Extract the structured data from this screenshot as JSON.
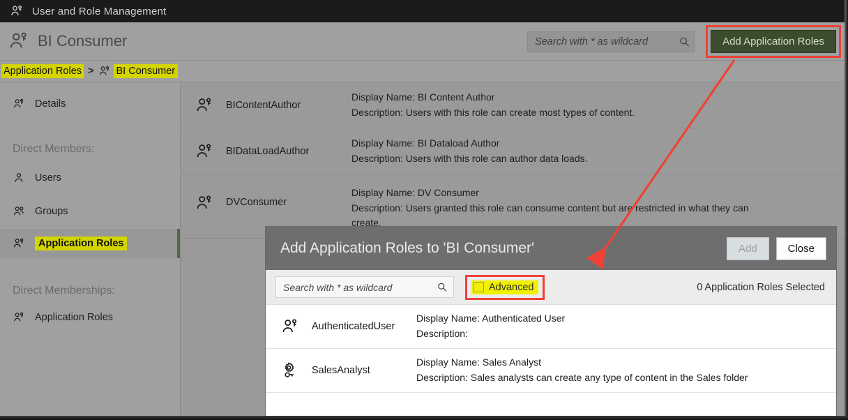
{
  "appbar": {
    "icon": "user-role-icon",
    "title": "User and Role Management"
  },
  "page_header": {
    "icon": "user-role-icon",
    "title": "BI Consumer",
    "search": {
      "placeholder": "Search with * as wildcard",
      "value": "",
      "icon": "search-icon"
    },
    "add_button_label": "Add Application Roles",
    "add_button_color": "#3c4c2f",
    "highlight_color": "#ef4136"
  },
  "breadcrumb": {
    "root_label": "Application Roles",
    "separator": ">",
    "leaf_icon": "user-role-icon",
    "leaf_label": "BI Consumer",
    "highlight_color": "#d4d400"
  },
  "sidebar": {
    "items": [
      {
        "label": "Details",
        "icon": "user-role-icon",
        "selected": false
      },
      {
        "label": "Direct Members:",
        "icon": "",
        "group": true
      },
      {
        "label": "Users",
        "icon": "user-icon",
        "selected": false
      },
      {
        "label": "Groups",
        "icon": "group-icon",
        "selected": false
      },
      {
        "label": "Application Roles",
        "icon": "user-role-icon",
        "selected": true
      },
      {
        "label": "Direct Memberships:",
        "icon": "",
        "group": true
      },
      {
        "label": "Application Roles",
        "icon": "user-role-icon",
        "selected": false
      }
    ],
    "selected_accent_color": "#4f6b3e"
  },
  "main_list": {
    "rows": [
      {
        "icon": "user-role-icon",
        "name": "BIContentAuthor",
        "display_name": "Display Name: BI Content Author",
        "description": "Description: Users with this role can create most types of content."
      },
      {
        "icon": "user-role-icon",
        "name": "BIDataLoadAuthor",
        "display_name": "Display Name: BI Dataload Author",
        "description": "Description: Users with this role can author data loads."
      },
      {
        "icon": "user-role-icon",
        "name": "DVConsumer",
        "display_name": "Display Name: DV Consumer",
        "description": "Description: Users granted this role can consume content but are restricted in what they can create."
      }
    ]
  },
  "modal": {
    "title": "Add Application Roles to 'BI Consumer'",
    "add_label": "Add",
    "add_disabled": true,
    "close_label": "Close",
    "search": {
      "placeholder": "Search with * as wildcard",
      "value": "",
      "icon": "search-icon"
    },
    "advanced": {
      "label": "Advanced",
      "checked": false,
      "highlight_color": "#f0f000",
      "box_color": "#ef4136"
    },
    "selected_count_text": "0 Application Roles Selected",
    "rows": [
      {
        "icon": "user-role-icon",
        "name": "AuthenticatedUser",
        "display_name": "Display Name: Authenticated User",
        "description": "Description:"
      },
      {
        "icon": "gear-role-icon",
        "name": "SalesAnalyst",
        "display_name": "Display Name: Sales Analyst",
        "description": "Description: Sales analysts can create any type of content in the Sales folder"
      }
    ]
  },
  "annotation": {
    "arrow_color": "#ef4136"
  }
}
